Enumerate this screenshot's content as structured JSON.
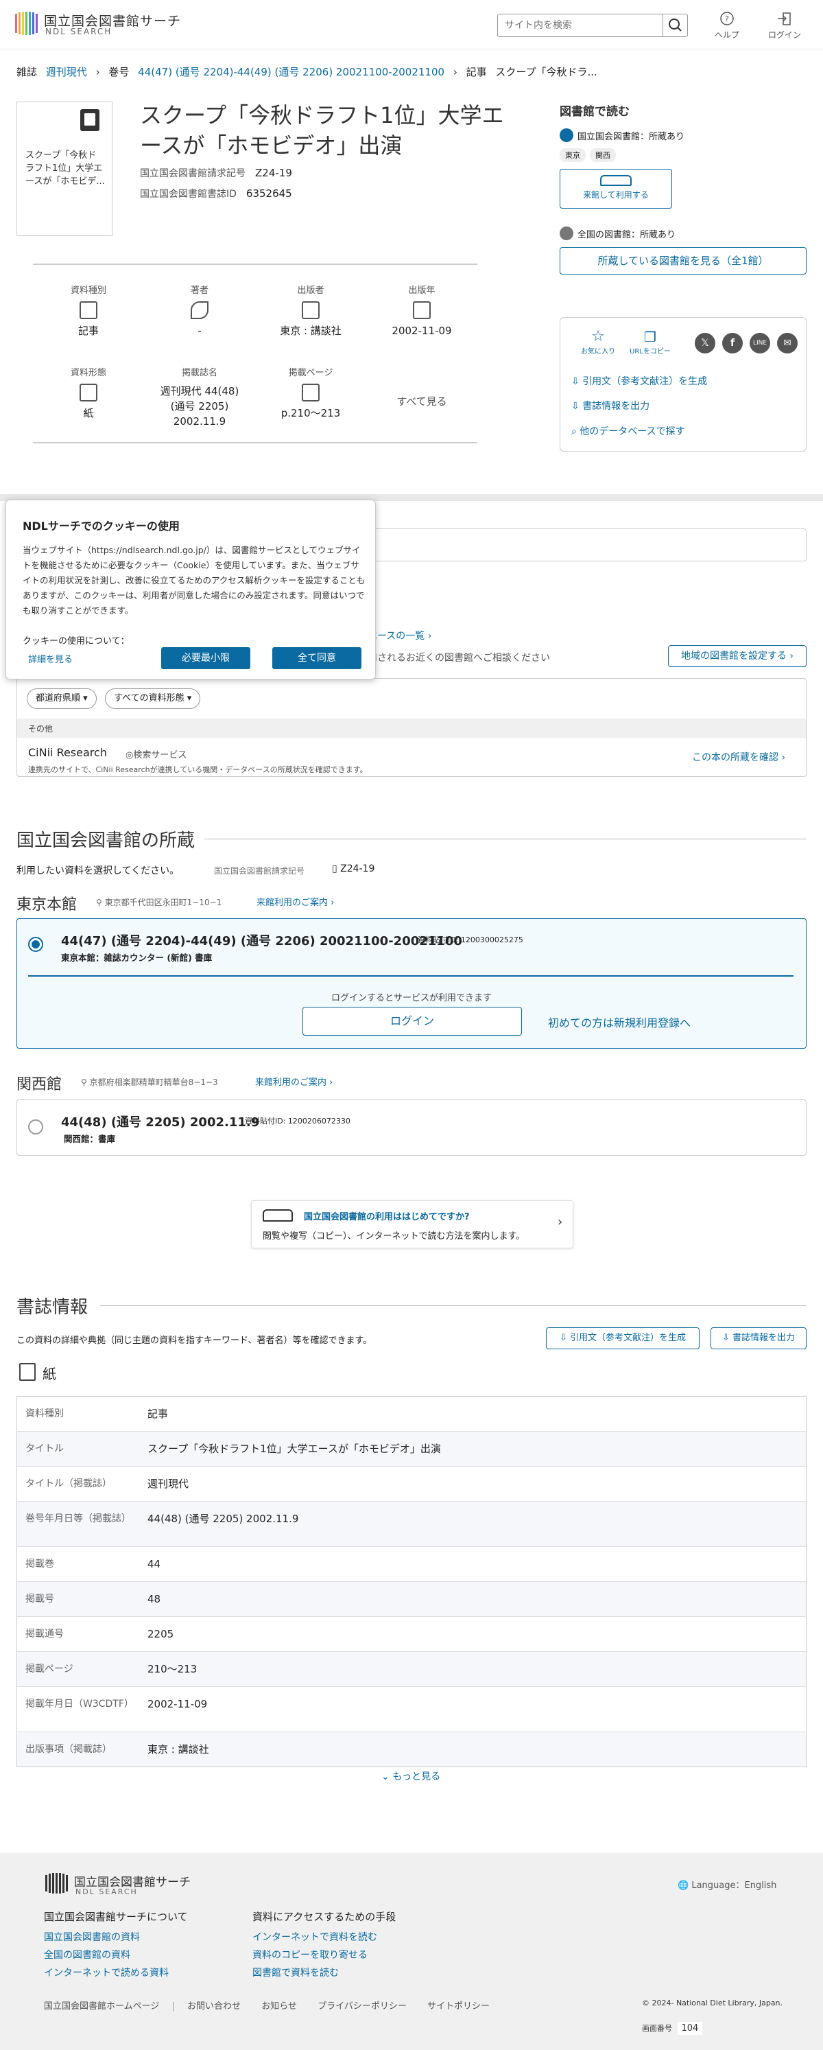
{
  "header": {
    "logo_jp": "国立国会図書館サーチ",
    "logo_en": "NDL SEARCH",
    "search_placeholder": "サイト内を検索",
    "help_label": "ヘルプ",
    "login_label": "ログイン"
  },
  "breadcrumb": {
    "item1": "雑誌",
    "item2": "週刊現代",
    "item3": "巻号",
    "item4": "44(47) (通号 2204)-44(49) (通号 2206) 20021100-20021100",
    "item5": "記事",
    "item6": "スクープ「今秋ドラ..."
  },
  "item": {
    "thumb_text": "スクープ「今秋ドラフト1位」大学エースが「ホモビデ...",
    "title": "スクープ「今秋ドラフト1位」大学エースが「ホモビデオ」出演",
    "call_no_label": "国立国会図書館請求記号",
    "call_no": "Z24-19",
    "biblio_id_label": "国立国会図書館書誌ID",
    "biblio_id": "6352645"
  },
  "facts": [
    {
      "label": "資料種別",
      "value": "記事"
    },
    {
      "label": "著者",
      "value": "-"
    },
    {
      "label": "出版者",
      "value": "東京 : 講談社"
    },
    {
      "label": "出版年",
      "value": "2002-11-09"
    },
    {
      "label": "資料形態",
      "value": "紙"
    },
    {
      "label": "掲載誌名",
      "value": "週刊現代 44(48) (通号 2205) 2002.11.9"
    },
    {
      "label": "掲載ページ",
      "value": "p.210〜213"
    }
  ],
  "facts_more": "すべて見る",
  "side": {
    "heading": "図書館で読む",
    "ndl_holding": "国立国会図書館：所蔵あり",
    "tag1": "東京",
    "tag2": "関西",
    "visit_btn": "来館して利用する",
    "all_holding": "全国の図書館：所蔵あり",
    "libs_btn": "所蔵している図書館を見る（全1館）",
    "favorite": "お気に入り",
    "copy_url": "URLをコピー",
    "cite": "引用文（参考文献注）を生成",
    "export": "書誌情報を出力",
    "other_db": "他のデータベースで探す"
  },
  "cookie": {
    "title": "NDLサーチでのクッキーの使用",
    "body": "当ウェブサイト（https://ndlsearch.ndl.go.jp/）は、図書館サービスとしてウェブサイトを機能させるために必要なクッキー（Cookie）を使用しています。また、当ウェブサイトの利用状況を計測し、改善に役立てるためのアクセス解析クッキーを設定することもありますが、このクッキーは、利用者が同意した場合にのみ設定されます。同意はいつでも取り消すことができます。",
    "about": "クッキーの使用について：",
    "detail_link": "詳細を見る",
    "min_btn": "必要最小限",
    "agree_btn": "全て同意"
  },
  "libs": {
    "db_list_link": "ベースの一覧",
    "note": "用されるお近くの図書館へご相談ください",
    "region_btn": "地域の図書館を設定する",
    "pref_select": "都道府県順",
    "type_select": "すべての資料形態",
    "other_label": "その他",
    "cinii_name": "CiNii Research",
    "cinii_type": "検索サービス",
    "cinii_desc": "連携先のサイトで、CiNii Researchが連携している機関・データベースの所蔵状況を確認できます。",
    "cinii_link": "この本の所蔵を確認"
  },
  "ndl": {
    "heading": "国立国会図書館の所蔵",
    "select_text": "利用したい資料を選択してください。",
    "call_label": "国立国会図書館請求記号",
    "call_no": "Z24-19",
    "tokyo": {
      "name": "東京本館",
      "address": "東京都千代田区永田町1−10−1",
      "guide": "来館利用のご案内",
      "vol": "44(47) (通号 2204)-44(49) (通号 2206) 20021100-20021100",
      "attach": "資料貼付ID: 1200300025275",
      "loc": "東京本館：雑誌カウンター (新館) 書庫",
      "login_note": "ログインするとサービスが利用できます",
      "login_btn": "ログイン",
      "register": "初めての方は新規利用登録へ"
    },
    "kansai": {
      "name": "関西館",
      "address": "京都府相楽郡精華町精華台8−1−3",
      "guide": "来館利用のご案内",
      "vol": "44(48) (通号 2205) 2002.11.9",
      "attach": "資料貼付ID: 1200206072330",
      "loc": "関西館：書庫"
    },
    "first_time_title": "国立国会図書館の利用ははじめてですか?",
    "first_time_desc": "閲覧や複写（コピー）、インターネットで読む方法を案内します。"
  },
  "biblio": {
    "heading": "書誌情報",
    "desc": "この資料の詳細や典拠（同じ主題の資料を指すキーワード、著者名）等を確認できます。",
    "cite_btn": "引用文（参考文献注）を生成",
    "export_btn": "書誌情報を出力",
    "form": "紙",
    "rows": [
      {
        "k": "資料種別",
        "v": "記事"
      },
      {
        "k": "タイトル",
        "v": "スクープ「今秋ドラフト1位」大学エースが「ホモビデオ」出演"
      },
      {
        "k": "タイトル（掲載誌）",
        "v": "週刊現代"
      },
      {
        "k": "巻号年月日等（掲載誌）",
        "v": "44(48) (通号 2205) 2002.11.9"
      },
      {
        "k": "掲載巻",
        "v": "44"
      },
      {
        "k": "掲載号",
        "v": "48"
      },
      {
        "k": "掲載通号",
        "v": "2205"
      },
      {
        "k": "掲載ページ",
        "v": "210〜213"
      },
      {
        "k": "掲載年月日（W3CDTF）",
        "v": "2002-11-09"
      },
      {
        "k": "出版事項（掲載誌）",
        "v": "東京 : 講談社"
      }
    ],
    "more": "もっと見る"
  },
  "footer": {
    "language": "Language：English",
    "about_head": "国立国会図書館サーチについて",
    "about1": "国立国会図書館の資料",
    "about2": "全国の図書館の資料",
    "about3": "インターネットで読める資料",
    "access_head": "資料にアクセスするための手段",
    "access1": "インターネットで資料を読む",
    "access2": "資料のコピーを取り寄せる",
    "access3": "図書館で資料を読む",
    "bottom1": "国立国会図書館ホームページ",
    "bottom2": "お問い合わせ",
    "bottom3": "お知らせ",
    "bottom4": "プライバシーポリシー",
    "bottom5": "サイトポリシー",
    "copyright": "© 2024- National Diet Library, Japan.",
    "screen_no_label": "画面番号",
    "screen_no": "104"
  },
  "colors": {
    "accent": "#0a6aa1",
    "panel_bg": "#f2fafd",
    "footer_bg": "#f0f0f0"
  },
  "icons": [
    "search-icon",
    "help-icon",
    "login-icon",
    "book-icon",
    "star-icon",
    "copy-icon",
    "x-icon",
    "facebook-icon",
    "line-icon",
    "mail-icon",
    "radio-icon",
    "car-icon",
    "chevron-right-icon",
    "chevron-down-icon",
    "location-icon",
    "document-icon",
    "translate-icon"
  ]
}
